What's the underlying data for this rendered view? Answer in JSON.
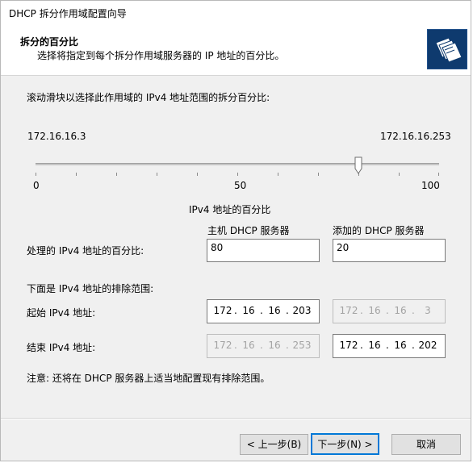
{
  "window": {
    "title": "DHCP 拆分作用域配置向导"
  },
  "header": {
    "title": "拆分的百分比",
    "subtitle": "选择将指定到每个拆分作用域服务器的 IP 地址的百分比。",
    "icon": "wizard-folder-icon"
  },
  "slider": {
    "instruction": "滚动滑块以选择此作用域的 IPv4 地址范围的拆分百分比:",
    "start_ip": "172.16.16.3",
    "end_ip": "172.16.16.253",
    "min_label": "0",
    "mid_label": "50",
    "max_label": "100",
    "caption": "IPv4 地址的百分比",
    "value_percent": 80
  },
  "servers": {
    "host_header": "主机 DHCP 服务器",
    "added_header": "添加的 DHCP 服务器",
    "percent_label": "处理的 IPv4 地址的百分比:",
    "host_percent": "80",
    "added_percent": "20"
  },
  "exclusion": {
    "heading": "下面是 IPv4 地址的排除范围:",
    "start_label": "起始 IPv4 地址:",
    "end_label": "结束 IPv4 地址:",
    "host_start": [
      "172",
      "16",
      "16",
      "203"
    ],
    "added_start": [
      "172",
      "16",
      "16",
      "3"
    ],
    "host_end": [
      "172",
      "16",
      "16",
      "253"
    ],
    "added_end": [
      "172",
      "16",
      "16",
      "202"
    ],
    "note": "注意: 还将在 DHCP 服务器上适当地配置现有排除范围。"
  },
  "buttons": {
    "back": "< 上一步(B)",
    "next": "下一步(N) >",
    "cancel": "取消"
  },
  "colors": {
    "accent": "#0078d7",
    "icon_bg": "#0e3a6e"
  }
}
